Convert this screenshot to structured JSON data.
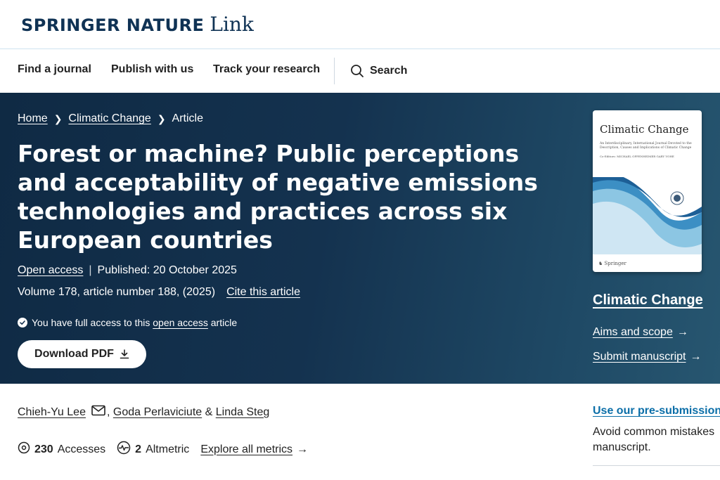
{
  "header": {
    "brand": "SPRINGER NATURE",
    "brand_suffix": "Link"
  },
  "nav": {
    "items": [
      {
        "label": "Find a journal"
      },
      {
        "label": "Publish with us"
      },
      {
        "label": "Track your research"
      }
    ],
    "search_label": "Search"
  },
  "breadcrumb": {
    "items": [
      "Home",
      "Climatic Change",
      "Article"
    ]
  },
  "article": {
    "title": "Forest or machine? Public perceptions and acceptability of negative emissions technologies and practices across six European countries",
    "open_access": "Open access",
    "published": "Published: 20 October 2025",
    "volume": "Volume 178, article number 188, (2025)",
    "cite": "Cite this article",
    "access_prefix": "You have full access to this",
    "access_link": "open access",
    "access_suffix": "article",
    "download_label": "Download PDF"
  },
  "journal": {
    "cover_title": "Climatic Change",
    "cover_subtitle": "An Interdisciplinary, International Journal Devoted to the Description, Causes and Implications of Climatic Change",
    "cover_editors_label": "Co-Editors:",
    "cover_editors": "MICHAEL OPPENHEIMER GARY YOHE",
    "cover_publisher": "Springer",
    "name": "Climatic Change",
    "aims": "Aims and scope",
    "submit": "Submit manuscript"
  },
  "authors": [
    "Chieh-Yu Lee",
    "Goda Perlaviciute",
    "Linda Steg"
  ],
  "author_separators": [
    ",",
    "&"
  ],
  "metrics": {
    "accesses_value": "230",
    "accesses_label": "Accesses",
    "altmetric_value": "2",
    "altmetric_label": "Altmetric",
    "explore": "Explore all metrics"
  },
  "promo": {
    "title": "Use our pre-submission",
    "body": "Avoid common mistakes manuscript."
  },
  "colors": {
    "brand_navy": "#0f3254",
    "hero_bg": "#14324f",
    "link_blue": "#0b6ea8"
  }
}
